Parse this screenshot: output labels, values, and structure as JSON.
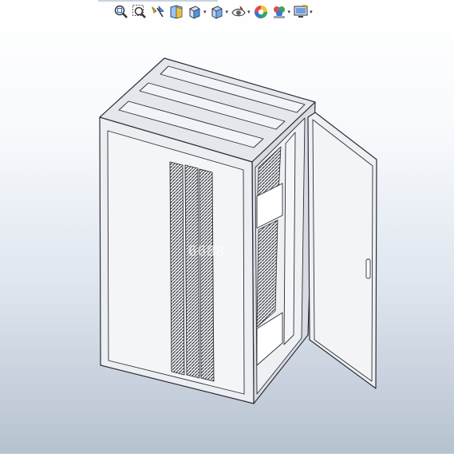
{
  "toolbar": {
    "items": [
      {
        "name": "zoom-to-fit",
        "icon": "zoom-fit-icon",
        "has_menu": false
      },
      {
        "name": "zoom-to-area",
        "icon": "zoom-area-icon",
        "has_menu": false
      },
      {
        "name": "previous-view",
        "icon": "previous-view-icon",
        "has_menu": false
      },
      {
        "name": "section-view",
        "icon": "section-view-icon",
        "has_menu": false
      },
      {
        "name": "view-orientation",
        "icon": "view-orientation-icon",
        "has_menu": true
      },
      {
        "name": "display-style",
        "icon": "display-style-icon",
        "has_menu": true
      },
      {
        "name": "hide-show-items",
        "icon": "hide-show-icon",
        "has_menu": true
      },
      {
        "name": "edit-appearance",
        "icon": "appearance-icon",
        "has_menu": false
      },
      {
        "name": "apply-scene",
        "icon": "scene-icon",
        "has_menu": true
      },
      {
        "name": "view-settings",
        "icon": "view-settings-icon",
        "has_menu": true
      }
    ],
    "caret_glyph": "▾"
  },
  "viewport": {
    "model": "cabinet-assembly",
    "watermark": "6688",
    "colors": {
      "body_fill": "#eceef1",
      "top_fill": "#e4e7ec",
      "edge": "#2b2f36",
      "vent": "#3a3e45",
      "background_top": "#ffffff",
      "background_bottom": "#b7c2d0"
    }
  }
}
